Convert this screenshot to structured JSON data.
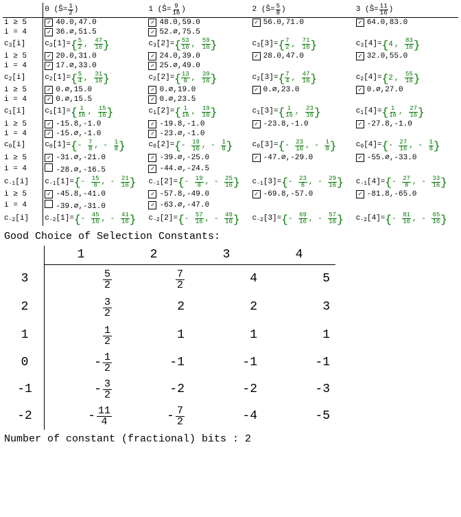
{
  "top_table": {
    "row_labels": [
      "i ≥ 5",
      "i = 4",
      "c₃[i]",
      "i ≥ 5",
      "i = 4",
      "c₂[i]",
      "i ≥ 5",
      "i = 4",
      "c₁[i]",
      "i ≥ 5",
      "i = 4",
      "c₀[i]",
      "i ≥ 5",
      "i = 4",
      "c₋₁[i]",
      "i ≥ 5",
      "i = 4",
      "c₋₂[i]"
    ],
    "columns": [
      {
        "idx": "0",
        "s_hat": {
          "num": "1",
          "den": "2"
        }
      },
      {
        "idx": "1",
        "s_hat": {
          "num": "9",
          "den": "16"
        }
      },
      {
        "idx": "2",
        "s_hat": {
          "num": "5",
          "den": "8"
        }
      },
      {
        "idx": "3",
        "s_hat": {
          "num": "11",
          "den": "16"
        }
      }
    ],
    "cells": [
      [
        {
          "t": "chk",
          "chk": true,
          "v": "40.0,47.0"
        },
        {
          "t": "chk",
          "chk": true,
          "v": "48.0,59.0"
        },
        {
          "t": "chk",
          "chk": true,
          "v": "56.0,71.0"
        },
        {
          "t": "chk",
          "chk": true,
          "v": "64.0,83.0"
        }
      ],
      [
        {
          "t": "chk",
          "chk": true,
          "v": "36.∅,51.5"
        },
        {
          "t": "chk",
          "chk": true,
          "v": "52.∅,75.5"
        },
        null,
        null
      ],
      [
        {
          "t": "expr",
          "pre": "c₃[1]=",
          "a": {
            "f": [
              "5",
              "2"
            ]
          },
          "b": {
            "f": [
              "47",
              "16"
            ]
          }
        },
        {
          "t": "expr",
          "pre": "c₃[2]=",
          "a": {
            "f": [
              "53",
              "16"
            ]
          },
          "b": {
            "f": [
              "59",
              "16"
            ]
          }
        },
        {
          "t": "expr",
          "pre": "c₃[3]=",
          "a": {
            "f": [
              "7",
              "2"
            ]
          },
          "b": {
            "f": [
              "71",
              "16"
            ]
          }
        },
        {
          "t": "expr",
          "pre": "c₃[4]=",
          "a": {
            "p": "4"
          },
          "b": {
            "f": [
              "83",
              "16"
            ]
          }
        }
      ],
      [
        {
          "t": "chk",
          "chk": true,
          "v": "20.0,31.0"
        },
        {
          "t": "chk",
          "chk": true,
          "v": "24.0,39.0"
        },
        {
          "t": "chk",
          "chk": true,
          "v": "28.0,47.0"
        },
        {
          "t": "chk",
          "chk": true,
          "v": "32.0,55.0"
        }
      ],
      [
        {
          "t": "chk",
          "chk": true,
          "v": "17.∅,33.0"
        },
        {
          "t": "chk",
          "chk": true,
          "v": "25.∅,49.0"
        },
        null,
        null
      ],
      [
        {
          "t": "expr",
          "pre": "c₂[1]=",
          "a": {
            "f": [
              "5",
              "4"
            ]
          },
          "b": {
            "f": [
              "31",
              "16"
            ]
          }
        },
        {
          "t": "expr",
          "pre": "c₂[2]=",
          "a": {
            "f": [
              "13",
              "8"
            ]
          },
          "b": {
            "f": [
              "39",
              "16"
            ]
          }
        },
        {
          "t": "expr",
          "pre": "c₂[3]=",
          "a": {
            "f": [
              "7",
              "4"
            ]
          },
          "b": {
            "f": [
              "47",
              "16"
            ]
          }
        },
        {
          "t": "expr",
          "pre": "c₂[4]=",
          "a": {
            "p": "2"
          },
          "b": {
            "f": [
              "55",
              "16"
            ]
          }
        }
      ],
      [
        {
          "t": "chk",
          "chk": true,
          "v": "0.∅,15.0"
        },
        {
          "t": "chk",
          "chk": true,
          "v": "0.∅,19.0"
        },
        {
          "t": "chk",
          "chk": true,
          "v": "0.∅,23.0"
        },
        {
          "t": "chk",
          "chk": true,
          "v": "0.∅,27.0"
        }
      ],
      [
        {
          "t": "chk",
          "chk": true,
          "v": "0.∅,15.5"
        },
        {
          "t": "chk",
          "chk": true,
          "v": "0.∅,23.5"
        },
        null,
        null
      ],
      [
        {
          "t": "expr",
          "pre": "c₁[1]=",
          "a": {
            "f": [
              "1",
              "16"
            ]
          },
          "b": {
            "f": [
              "15",
              "16"
            ]
          }
        },
        {
          "t": "expr",
          "pre": "c₁[2]=",
          "a": {
            "f": [
              "1",
              "16"
            ]
          },
          "b": {
            "f": [
              "19",
              "16"
            ]
          }
        },
        {
          "t": "expr",
          "pre": "c₁[3]=",
          "a": {
            "f": [
              "1",
              "16"
            ]
          },
          "b": {
            "f": [
              "23",
              "16"
            ]
          }
        },
        {
          "t": "expr",
          "pre": "c₁[4]=",
          "a": {
            "f": [
              "1",
              "16"
            ]
          },
          "b": {
            "f": [
              "27",
              "16"
            ]
          }
        }
      ],
      [
        {
          "t": "chk",
          "chk": true,
          "v": "-15.8,-1.0"
        },
        {
          "t": "chk",
          "chk": true,
          "v": "-19.8,-1.0"
        },
        {
          "t": "chk",
          "chk": true,
          "v": "-23.8,-1.0"
        },
        {
          "t": "chk",
          "chk": true,
          "v": "-27.8,-1.0"
        }
      ],
      [
        {
          "t": "chk",
          "chk": true,
          "v": "-15.∅,-1.0"
        },
        {
          "t": "chk",
          "chk": true,
          "v": "-23.∅,-1.0"
        },
        null,
        null
      ],
      [
        {
          "t": "expr",
          "pre": "c₀[1]=",
          "a": {
            "f": [
              "7",
              "8"
            ],
            "neg": true
          },
          "b": {
            "f": [
              "1",
              "8"
            ],
            "neg": true
          }
        },
        {
          "t": "expr",
          "pre": "c₀[2]=",
          "a": {
            "f": [
              "19",
              "16"
            ],
            "neg": true
          },
          "b": {
            "f": [
              "1",
              "8"
            ],
            "neg": true
          }
        },
        {
          "t": "expr",
          "pre": "c₀[3]=",
          "a": {
            "f": [
              "23",
              "16"
            ],
            "neg": true
          },
          "b": {
            "f": [
              "1",
              "8"
            ],
            "neg": true
          }
        },
        {
          "t": "expr",
          "pre": "c₀[4]=",
          "a": {
            "f": [
              "27",
              "16"
            ],
            "neg": true
          },
          "b": {
            "f": [
              "1",
              "8"
            ],
            "neg": true
          }
        }
      ],
      [
        {
          "t": "chk",
          "chk": true,
          "v": "-31.∅,-21.0"
        },
        {
          "t": "chk",
          "chk": true,
          "v": "-39.∅,-25.0"
        },
        {
          "t": "chk",
          "chk": true,
          "v": "-47.∅,-29.0"
        },
        {
          "t": "chk",
          "chk": true,
          "v": "-55.∅,-33.0"
        }
      ],
      [
        {
          "t": "chk",
          "chk": false,
          "v": "-28.∅,-16.5"
        },
        {
          "t": "chk",
          "chk": true,
          "v": "-44.∅,-24.5"
        },
        null,
        null
      ],
      [
        {
          "t": "expr",
          "pre": "c₋₁[1]=",
          "a": {
            "f": [
              "15",
              "8"
            ],
            "neg": true
          },
          "b": {
            "f": [
              "21",
              "16"
            ],
            "neg": true
          }
        },
        {
          "t": "expr",
          "pre": "c₋₁[2]=",
          "a": {
            "f": [
              "19",
              "8"
            ],
            "neg": true
          },
          "b": {
            "f": [
              "25",
              "16"
            ],
            "neg": true
          }
        },
        {
          "t": "expr",
          "pre": "c₋₁[3]=",
          "a": {
            "f": [
              "23",
              "8"
            ],
            "neg": true
          },
          "b": {
            "f": [
              "29",
              "16"
            ],
            "neg": true
          }
        },
        {
          "t": "expr",
          "pre": "c₋₁[4]=",
          "a": {
            "f": [
              "27",
              "8"
            ],
            "neg": true
          },
          "b": {
            "f": [
              "33",
              "16"
            ],
            "neg": true
          }
        }
      ],
      [
        {
          "t": "chk",
          "chk": true,
          "v": "-45.8,-41.0"
        },
        {
          "t": "chk",
          "chk": true,
          "v": "-57.8,-49.0"
        },
        {
          "t": "chk",
          "chk": true,
          "v": "-69.8,-57.0"
        },
        {
          "t": "chk",
          "chk": true,
          "v": "-81.8,-65.0"
        }
      ],
      [
        {
          "t": "chk",
          "chk": false,
          "v": "-39.∅,-31.0"
        },
        {
          "t": "chk",
          "chk": true,
          "v": "-63.∅,-47.0"
        },
        null,
        null
      ],
      [
        {
          "t": "expr",
          "pre": "c₋₂[1]=",
          "a": {
            "f": [
              "45",
              "16"
            ],
            "neg": true
          },
          "b": {
            "f": [
              "41",
              "16"
            ],
            "neg": true
          }
        },
        {
          "t": "expr",
          "pre": "c₋₂[2]=",
          "a": {
            "f": [
              "57",
              "16"
            ],
            "neg": true
          },
          "b": {
            "f": [
              "49",
              "16"
            ],
            "neg": true
          }
        },
        {
          "t": "expr",
          "pre": "c₋₂[3]=",
          "a": {
            "f": [
              "69",
              "16"
            ],
            "neg": true
          },
          "b": {
            "f": [
              "57",
              "16"
            ],
            "neg": true
          }
        },
        {
          "t": "expr",
          "pre": "c₋₂[4]=",
          "a": {
            "f": [
              "81",
              "16"
            ],
            "neg": true
          },
          "b": {
            "f": [
              "65",
              "16"
            ],
            "neg": true
          }
        }
      ]
    ]
  },
  "heading": "Good Choice of Selection Constants:",
  "sel_table": {
    "col_headers": [
      "1",
      "2",
      "3",
      "4"
    ],
    "rows": [
      {
        "label": "3",
        "cells": [
          {
            "f": [
              "5",
              "2"
            ]
          },
          {
            "f": [
              "7",
              "2"
            ]
          },
          {
            "p": "4"
          },
          {
            "p": "5"
          }
        ]
      },
      {
        "label": "2",
        "cells": [
          {
            "f": [
              "3",
              "2"
            ]
          },
          {
            "p": "2"
          },
          {
            "p": "2"
          },
          {
            "p": "3"
          }
        ]
      },
      {
        "label": "1",
        "cells": [
          {
            "f": [
              "1",
              "2"
            ]
          },
          {
            "p": "1"
          },
          {
            "p": "1"
          },
          {
            "p": "1"
          }
        ]
      },
      {
        "label": "0",
        "cells": [
          {
            "f": [
              "1",
              "2"
            ],
            "neg": true
          },
          {
            "p": "-1"
          },
          {
            "p": "-1"
          },
          {
            "p": "-1"
          }
        ]
      },
      {
        "label": "-1",
        "cells": [
          {
            "f": [
              "3",
              "2"
            ],
            "neg": true
          },
          {
            "p": "-2"
          },
          {
            "p": "-2"
          },
          {
            "p": "-3"
          }
        ]
      },
      {
        "label": "-2",
        "cells": [
          {
            "f": [
              "11",
              "4"
            ],
            "neg": true
          },
          {
            "f": [
              "7",
              "2"
            ],
            "neg": true
          },
          {
            "p": "-4"
          },
          {
            "p": "-5"
          }
        ]
      }
    ]
  },
  "footer": "Number of constant (fractional) bits : 2",
  "chart_data": {
    "type": "table",
    "title": "Good Choice of Selection Constants",
    "columns": [
      "row",
      "1",
      "2",
      "3",
      "4"
    ],
    "rows": [
      [
        "3",
        "5/2",
        "7/2",
        "4",
        "5"
      ],
      [
        "2",
        "3/2",
        "2",
        "2",
        "3"
      ],
      [
        "1",
        "1/2",
        "1",
        "1",
        "1"
      ],
      [
        "0",
        "-1/2",
        "-1",
        "-1",
        "-1"
      ],
      [
        "-1",
        "-3/2",
        "-2",
        "-2",
        "-3"
      ],
      [
        "-2",
        "-11/4",
        "-7/2",
        "-4",
        "-5"
      ]
    ]
  }
}
